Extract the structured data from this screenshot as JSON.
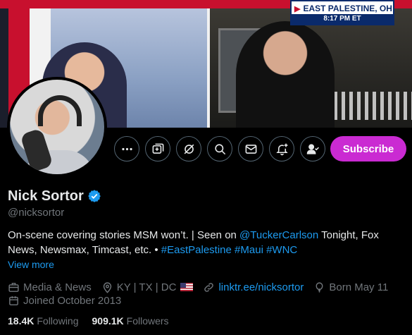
{
  "banner": {
    "chyron_location": "EAST PALESTINE, OH",
    "chyron_time": "8:17 PM ET"
  },
  "profile": {
    "name": "Nick Sortor",
    "handle": "@nicksortor",
    "bio": {
      "part1": "On-scene covering stories MSM won’t. | Seen on ",
      "mention": "@TuckerCarlson",
      "part2": " Tonight, Fox News, Newsmax, Timcast, etc. • ",
      "hashtags": [
        "#EastPalestine",
        "#Maui",
        "#WNC"
      ]
    },
    "view_more": "View more",
    "category": "Media & News",
    "location": "KY | TX | DC",
    "website": "linktr.ee/nicksortor",
    "birthday": "Born May 11",
    "joined": "Joined October 2013",
    "following_count": "18.4K",
    "following_label": "Following",
    "followers_count": "909.1K",
    "followers_label": "Followers"
  },
  "actions": {
    "subscribe_label": "Subscribe",
    "buttons": [
      "more-icon",
      "grok-icon",
      "grok-slash-icon",
      "search-icon",
      "message-icon",
      "notify-icon",
      "follow-icon"
    ]
  },
  "colors": {
    "accent": "#1d9bf0",
    "subscribe": "#ca2ad2",
    "muted": "#71767b",
    "background": "#000000"
  }
}
